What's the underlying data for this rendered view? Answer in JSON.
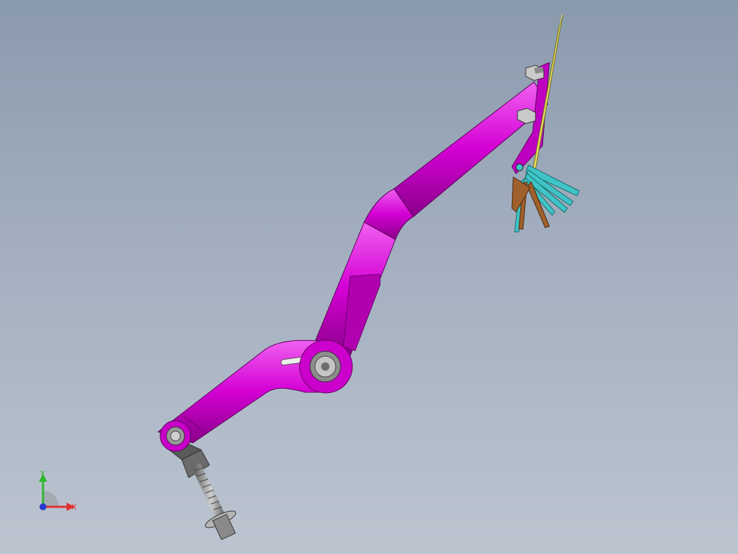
{
  "viewport": {
    "background_top": "#8a9aad",
    "background_bottom": "#bcc4d0"
  },
  "colors": {
    "arm": "#d400d4",
    "arm_dark": "#8a008a",
    "blade": "#e6d84a",
    "tine_cyan": "#3fc4c8",
    "tine_brown": "#9a5a2a",
    "bolt": "#9a9a9a"
  },
  "triad": {
    "y_label": "Y",
    "x_label": "X",
    "y_color": "#2db82d",
    "x_color": "#e03030",
    "z_color": "#2a3ad0"
  }
}
